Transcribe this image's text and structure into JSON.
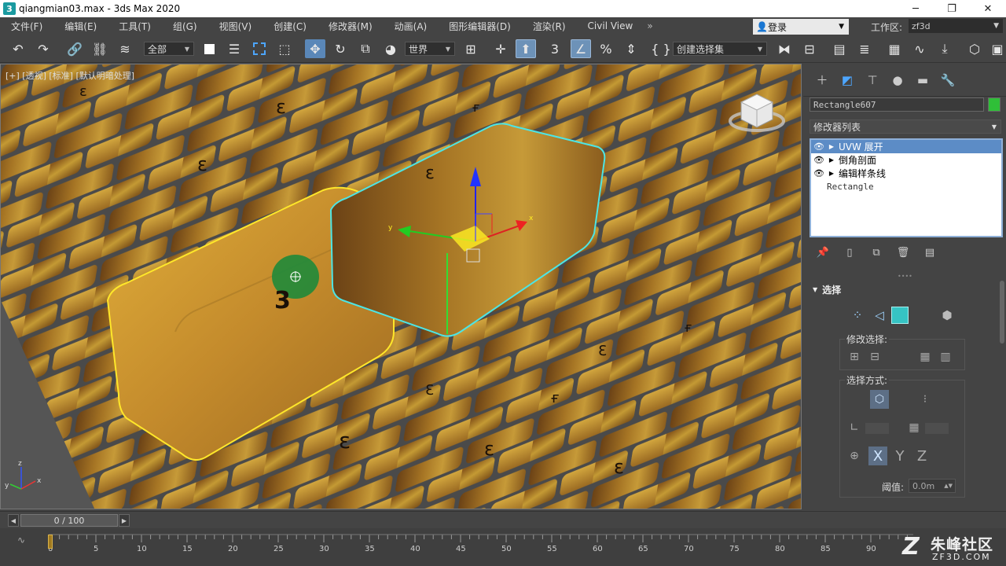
{
  "window": {
    "title": "qiangmian03.max - 3ds Max 2020",
    "app_icon": "3",
    "minimize": "─",
    "maximize": "❐",
    "close": "✕"
  },
  "menu": {
    "items": [
      "文件(F)",
      "编辑(E)",
      "工具(T)",
      "组(G)",
      "视图(V)",
      "创建(C)",
      "修改器(M)",
      "动画(A)",
      "图形编辑器(D)",
      "渲染(R)",
      "Civil View"
    ],
    "more": "»",
    "login": "登录",
    "workspace_label": "工作区:",
    "workspace_value": "zf3d"
  },
  "toolbar": {
    "filter_combo": "全部",
    "coord_combo": "世界",
    "named_selection_combo": "创建选择集",
    "snap_label": "3"
  },
  "viewport": {
    "label": "[+] [透视] [标准] [默认明暗处理]",
    "brick_glyph": "ε",
    "brick_glyph_alt": "Ɛ",
    "brick_glyph_f": "ғ",
    "brick_glyph_big": "3",
    "gizmo_x": "x",
    "gizmo_y": "y",
    "gizmo_z": "z"
  },
  "command_panel": {
    "object_name": "Rectangle607",
    "object_color": "#2fbf38",
    "modifier_list_label": "修改器列表",
    "stack": [
      {
        "name": "UVW 展开",
        "selected": true
      },
      {
        "name": "倒角剖面",
        "selected": false
      },
      {
        "name": "编辑样条线",
        "selected": false
      }
    ],
    "base_object": "Rectangle",
    "rollout_title": "选择",
    "modify_selection_label": "修改选择:",
    "select_by_label": "选择方式:",
    "threshold_label": "阈值:",
    "threshold_value": "0.0m",
    "xyz": [
      "X",
      "Y",
      "Z"
    ]
  },
  "timeline": {
    "frame_display": "0 / 100",
    "ticks": [
      "0",
      "5",
      "10",
      "15",
      "20",
      "25",
      "30",
      "35",
      "40",
      "45",
      "50",
      "55",
      "60",
      "65",
      "70",
      "75",
      "80",
      "85",
      "90"
    ],
    "current_frame": 0
  },
  "watermark": {
    "logo": "Z",
    "name": "朱峰社区",
    "url": "ZF3D.COM"
  }
}
